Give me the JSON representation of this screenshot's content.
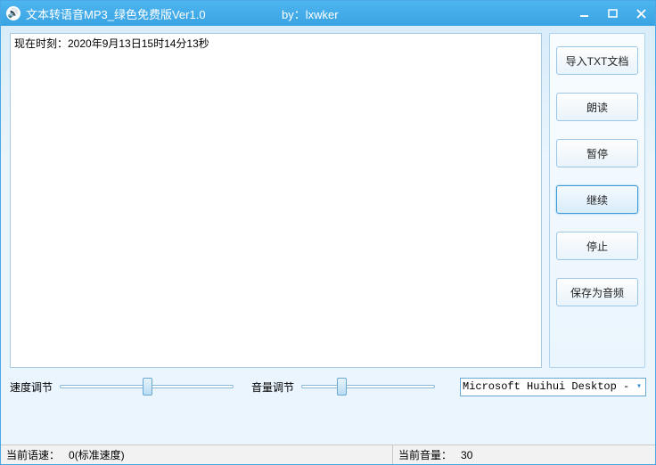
{
  "titlebar": {
    "title": "文本转语音MP3_绿色免费版Ver1.0",
    "by": "by：lxwker"
  },
  "textarea": {
    "content": "现在时刻：2020年9月13日15时14分13秒"
  },
  "buttons": {
    "import": "导入TXT文档",
    "read": "朗读",
    "pause": "暂停",
    "resume": "继续",
    "stop": "停止",
    "save": "保存为音频"
  },
  "sliders": {
    "speed_label": "速度调节",
    "speed_position_pct": 50,
    "volume_label": "音量调节",
    "volume_position_pct": 30
  },
  "voice_select": {
    "selected": "Microsoft Huihui Desktop - Ch"
  },
  "status": {
    "speed_label": "当前语速：",
    "speed_value": "0(标准速度)",
    "volume_label": "当前音量：",
    "volume_value": "30"
  }
}
